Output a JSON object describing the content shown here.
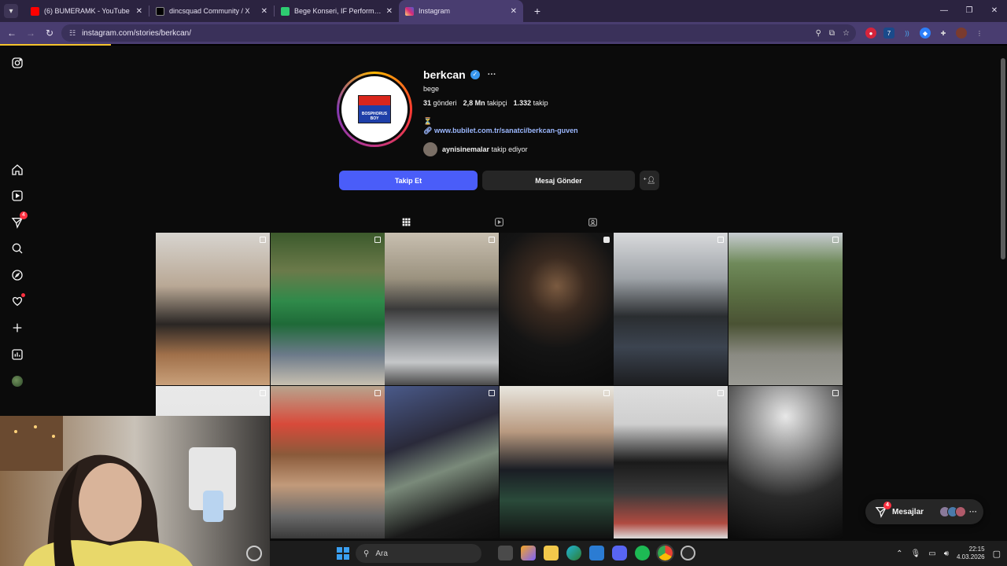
{
  "browser": {
    "tabs": [
      {
        "title": "(6) BUMERAMK - YouTube",
        "favicon_color": "#ff0000",
        "active": false
      },
      {
        "title": "dincsquad Community / X",
        "favicon_color": "#000000",
        "active": false
      },
      {
        "title": "Bege Konseri, IF Performance H",
        "favicon_color": "#2ecc71",
        "active": false
      },
      {
        "title": "Instagram",
        "favicon_color": "#e1306c",
        "active": true
      }
    ],
    "url": "instagram.com/stories/berkcan/",
    "accent": "#493d70"
  },
  "profile": {
    "username": "berkcan",
    "full_name": "bege",
    "posts_count": "31",
    "posts_label": "gönderi",
    "followers_count": "2,8 Mn",
    "followers_label": "takipçi",
    "following_count": "1.332",
    "following_label": "takip",
    "bio_emoji": "⏳",
    "link": "www.bubilet.com.tr/sanatci/berkcan-guven",
    "followed_by_user": "aynisinemalar",
    "followed_by_suffix": "takip ediyor",
    "avatar_logo_text": "BOSPHORUS BOY"
  },
  "actions": {
    "follow": "Takip Et",
    "message": "Mesaj Gönder",
    "follow_color": "#4a5df9"
  },
  "sidebar": {
    "messages_badge": "4"
  },
  "messages_pill": {
    "label": "Mesajlar",
    "badge": "4"
  },
  "taskbar": {
    "search_label": "Ara",
    "time": "22:15",
    "date": "4.03.2026"
  }
}
